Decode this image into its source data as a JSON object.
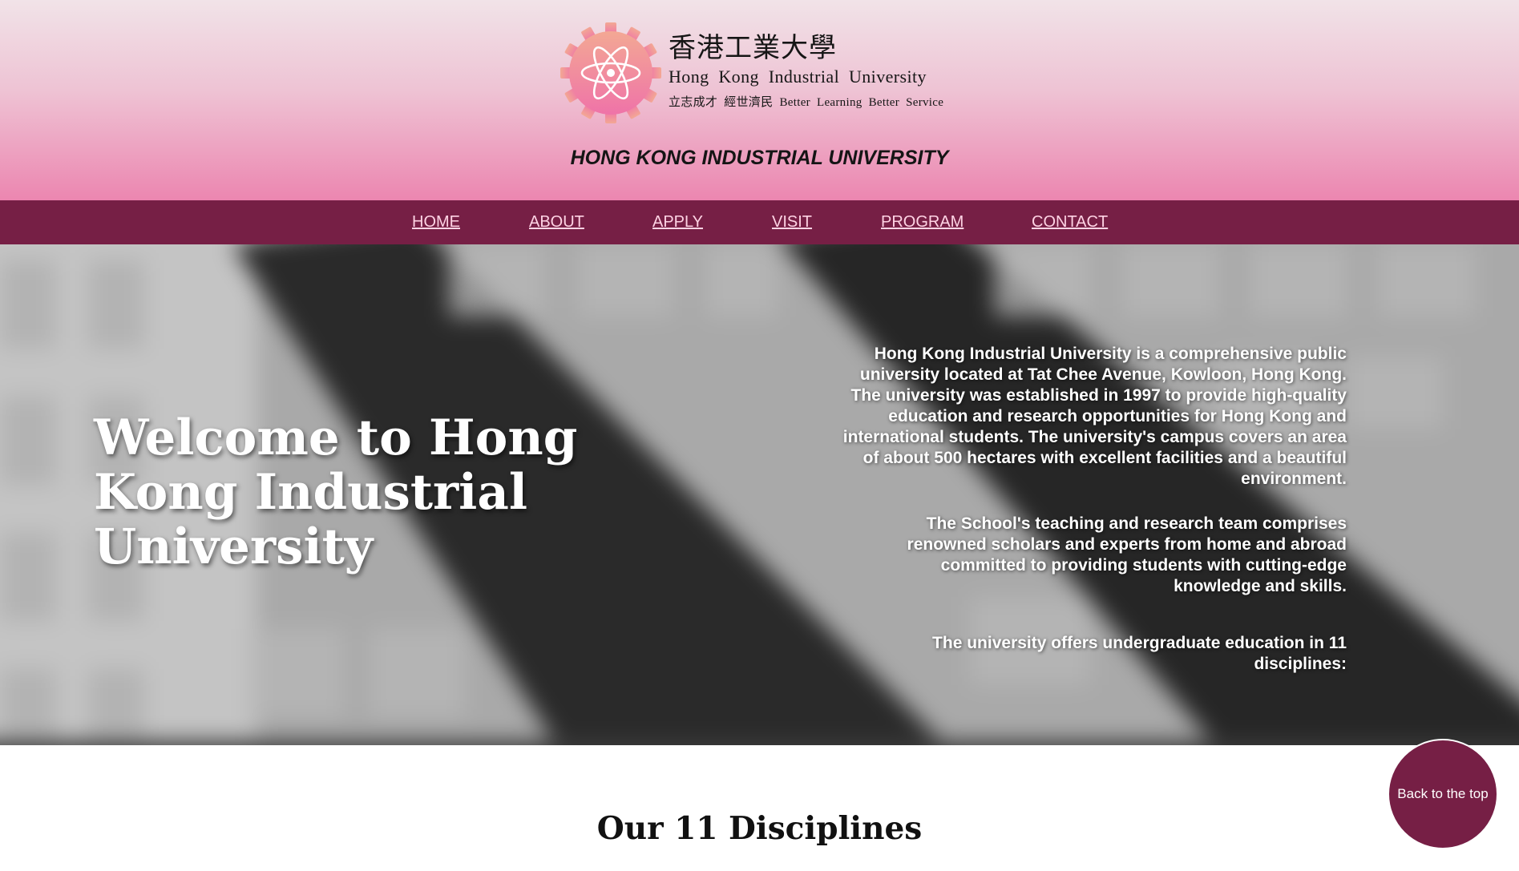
{
  "header": {
    "logo": {
      "chinese_name": "香港工業大學",
      "english_name": "Hong Kong Industrial University",
      "motto": "立志成才  經世濟民  Better Learning Better Service"
    },
    "site_title": "HONG KONG INDUSTRIAL UNIVERSITY"
  },
  "nav": {
    "items": [
      {
        "label": "HOME"
      },
      {
        "label": "ABOUT"
      },
      {
        "label": "APPLY"
      },
      {
        "label": "VISIT"
      },
      {
        "label": "PROGRAM"
      },
      {
        "label": "CONTACT"
      }
    ],
    "link_color": "#ffd3e4",
    "bar_color": "#761f45"
  },
  "hero": {
    "title": "Welcome to Hong Kong Industrial University",
    "paragraphs": [
      "Hong Kong Industrial University is a comprehensive public university located at Tat Chee Avenue, Kowloon, Hong Kong. The university was established in 1997 to provide high-quality education and research opportunities for Hong Kong and international students. The university's campus covers an area of about 500 hectares with excellent facilities and a beautiful environment.",
      "The School's teaching and research team comprises renowned scholars and experts from home and abroad committed to providing students with cutting-edge knowledge and skills.",
      "The university offers undergraduate education in 11 disciplines:"
    ]
  },
  "disciplines": {
    "heading": "Our 11 Disciplines"
  },
  "back_to_top": {
    "label": "Back to the top"
  },
  "icons": {
    "logo": "atom-gear-logo-icon"
  }
}
